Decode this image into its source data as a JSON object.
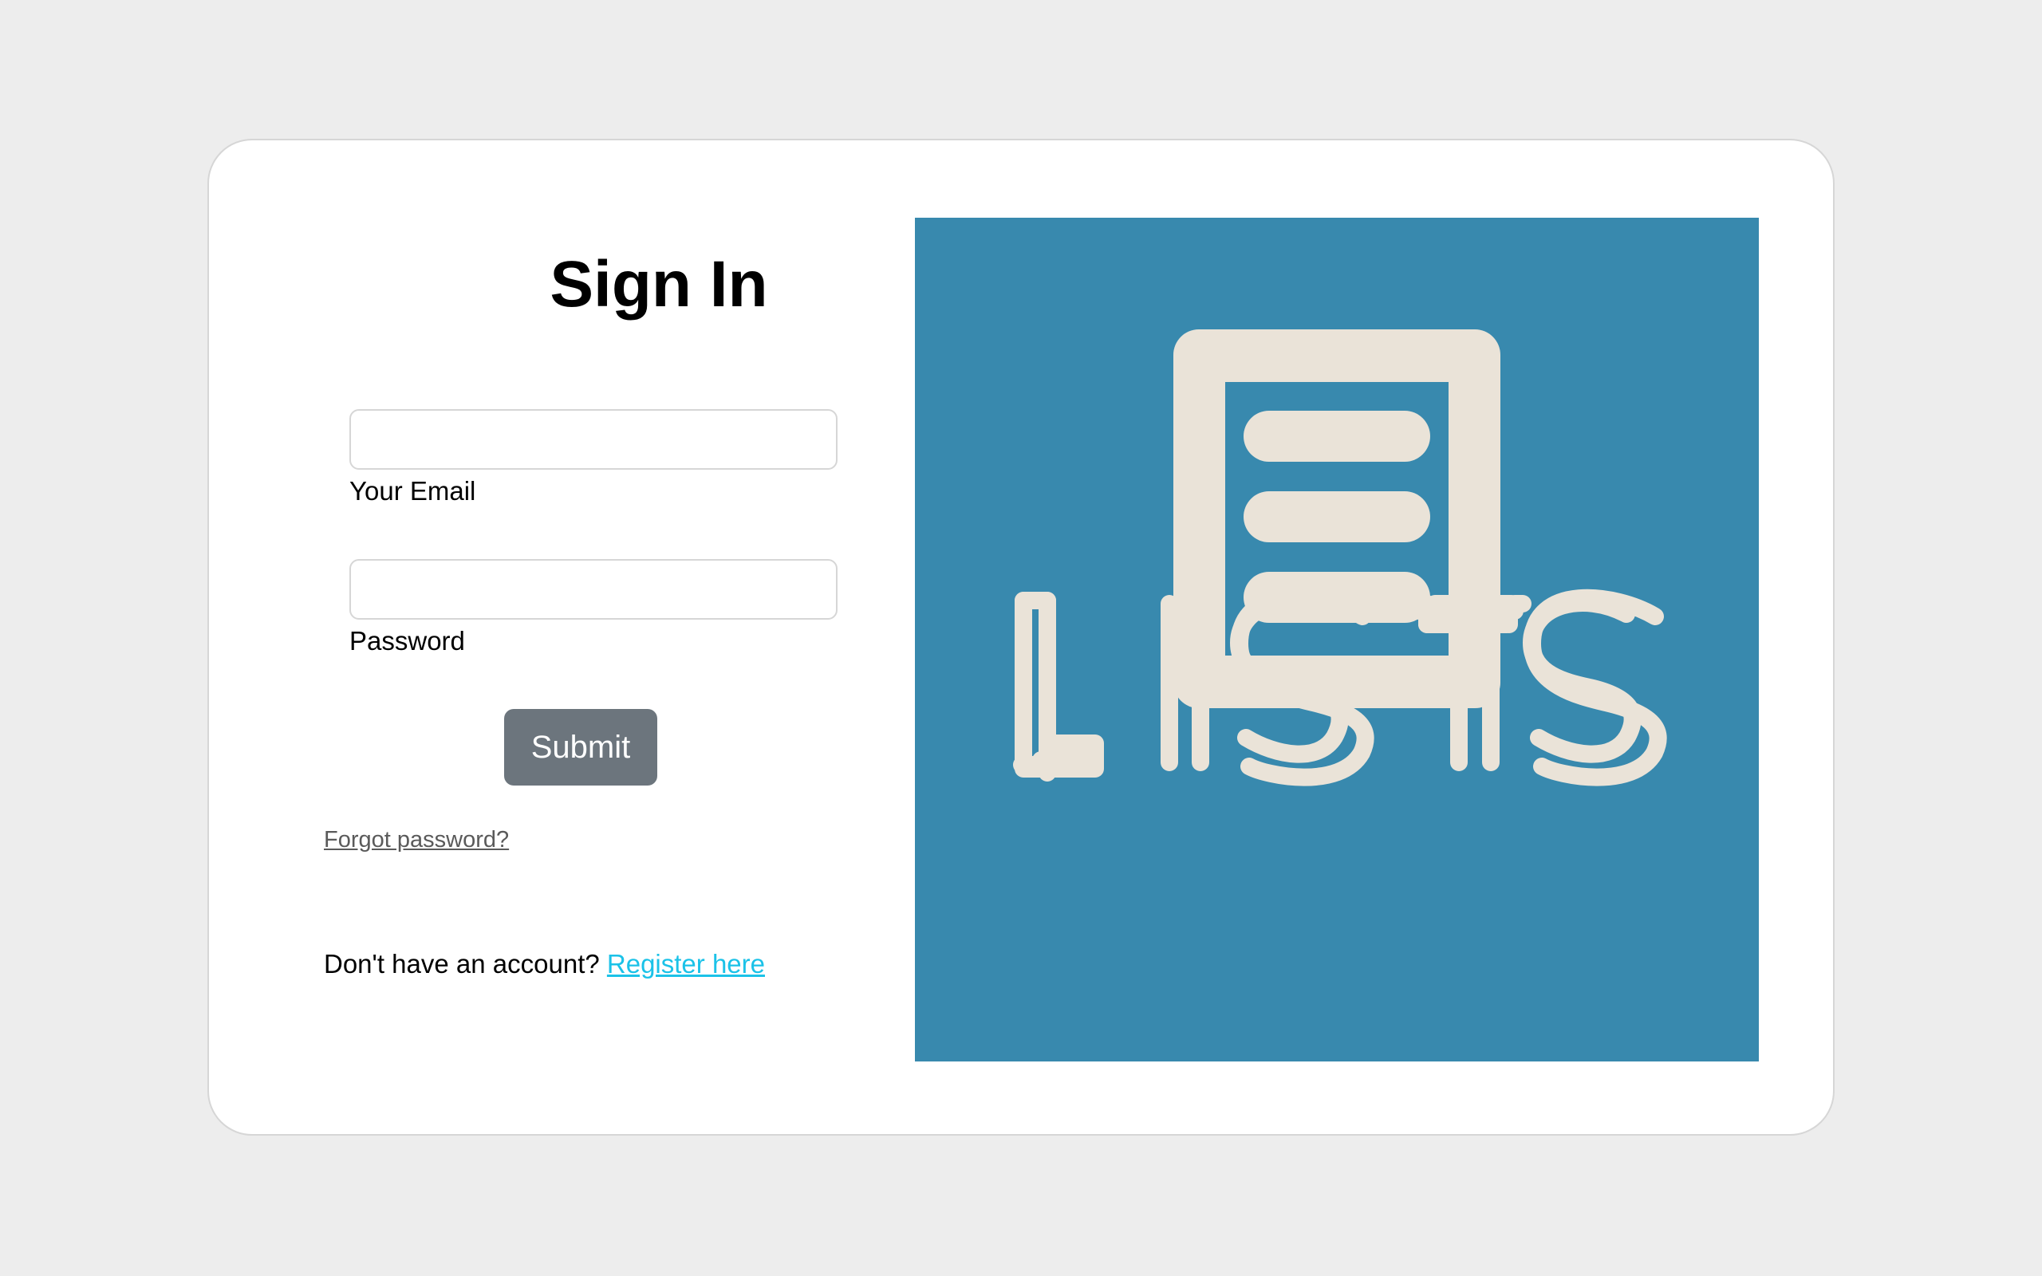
{
  "signin": {
    "title": "Sign In",
    "email_label": "Your Email",
    "email_value": "",
    "password_label": "Password",
    "password_value": "",
    "submit_label": "Submit",
    "forgot_label": "Forgot password?",
    "register_prompt": "Don't have an account?",
    "register_link": "Register here"
  },
  "logo": {
    "text": "LISTS",
    "icon": "list-document-icon",
    "background_color": "#3889ae",
    "foreground_color": "#eae3d8"
  },
  "colors": {
    "page_background": "#ededed",
    "card_background": "#ffffff",
    "button_background": "#6c757d",
    "link_color": "#1bc2e8"
  }
}
